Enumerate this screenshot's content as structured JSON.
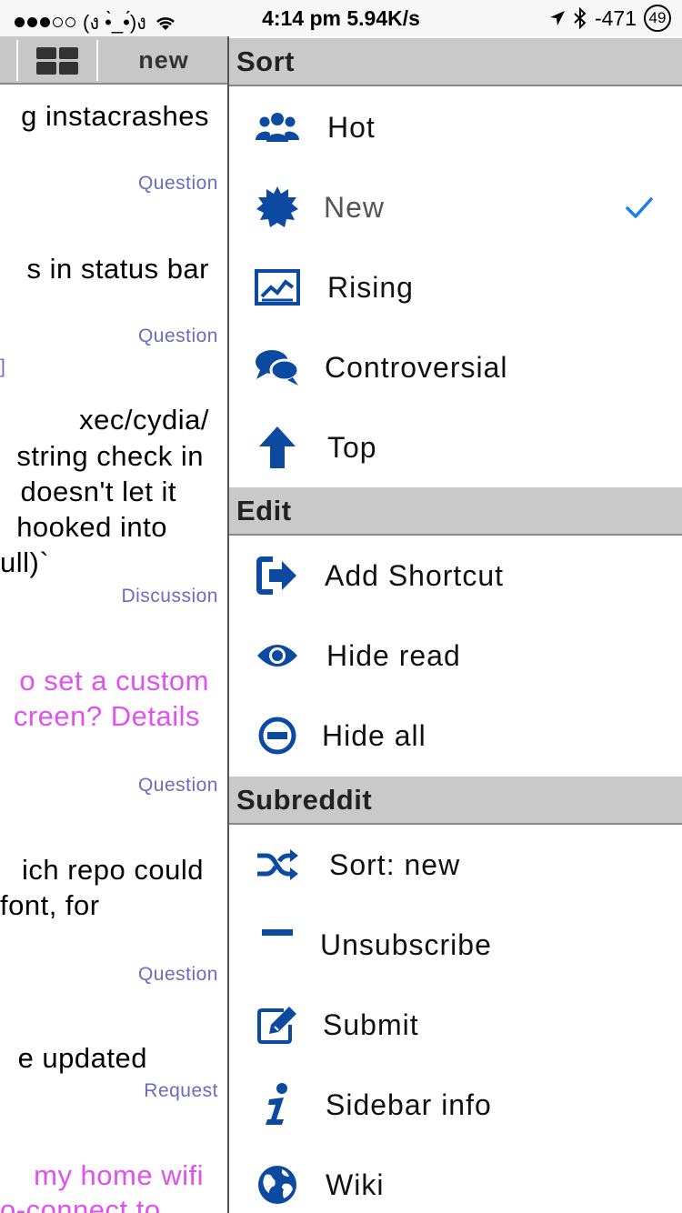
{
  "status_bar": {
    "carrier": "(ง •̀_•́)ง",
    "time_speed": "4:14 pm 5.94K/s",
    "signal": "-471",
    "battery": "49"
  },
  "toolbar": {
    "grid_icon": "grid-icon",
    "sort_label": "new"
  },
  "posts": [
    {
      "lines": [
        "g instacrashes"
      ],
      "flair": "Question"
    },
    {
      "lines": [
        "s in status bar"
      ],
      "flair": "Question",
      "extra": "]"
    },
    {
      "lines": [
        "xec/cydia/",
        "string check in",
        "doesn't let it",
        "hooked into",
        "ull)`"
      ],
      "flair": "Discussion"
    },
    {
      "lines": [
        "o set a custom",
        "creen? Details"
      ],
      "flair": "Question"
    },
    {
      "lines": [
        "ich repo could",
        "font, for"
      ],
      "flair": "Question"
    },
    {
      "lines": [
        "e updated"
      ],
      "flair": "Request"
    },
    {
      "lines": [
        "my home wifi",
        "o-connect to"
      ]
    }
  ],
  "menu": {
    "sort_header": "Sort",
    "sort_items": [
      {
        "label": "Hot",
        "icon": "users-icon"
      },
      {
        "label": "New",
        "icon": "badge-icon",
        "selected": true
      },
      {
        "label": "Rising",
        "icon": "chart-icon"
      },
      {
        "label": "Controversial",
        "icon": "chat-bubbles-icon"
      },
      {
        "label": "Top",
        "icon": "arrow-up-icon"
      }
    ],
    "edit_header": "Edit",
    "edit_items": [
      {
        "label": "Add Shortcut",
        "icon": "sign-out-icon"
      },
      {
        "label": "Hide read",
        "icon": "eye-icon"
      },
      {
        "label": "Hide all",
        "icon": "minus-circle-icon"
      }
    ],
    "subreddit_header": "Subreddit",
    "subreddit_items": [
      {
        "label": "Sort: new",
        "icon": "shuffle-icon"
      },
      {
        "label": "Unsubscribe",
        "icon": "minus-icon"
      },
      {
        "label": "Submit",
        "icon": "edit-icon"
      },
      {
        "label": "Sidebar info",
        "icon": "info-icon"
      },
      {
        "label": "Wiki",
        "icon": "globe-icon"
      }
    ]
  },
  "colors": {
    "icon_blue": "#0b4aa0",
    "check_blue": "#1a7ef2",
    "flair": "#6b6bbf",
    "pink_title": "#e052f0",
    "header_gray": "#c9c9c9"
  }
}
